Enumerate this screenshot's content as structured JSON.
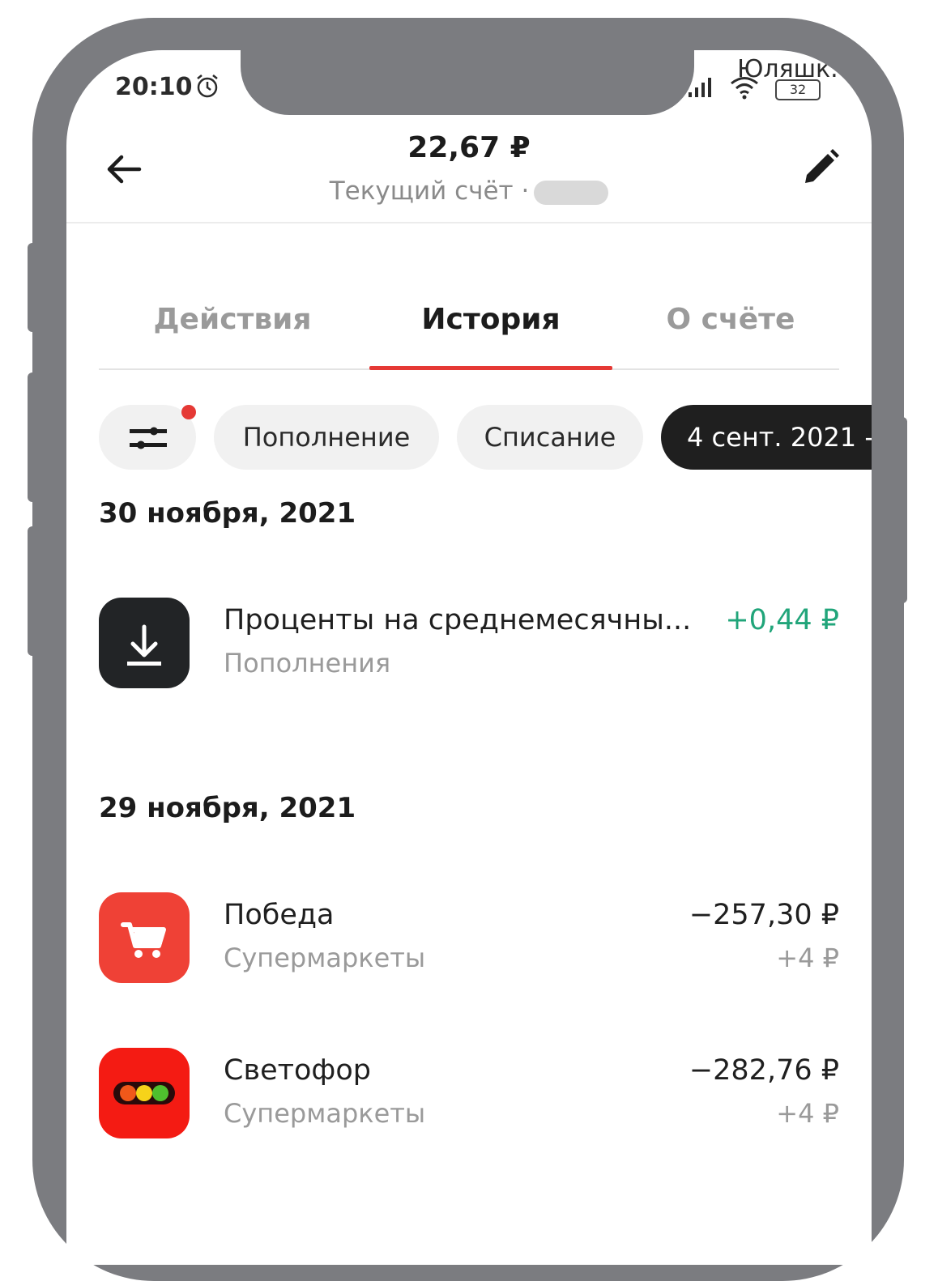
{
  "status_bar": {
    "time": "20:10",
    "carrier": "Юляшк.",
    "battery": "32"
  },
  "header": {
    "balance": "22,67 ₽",
    "account_label": "Текущий счёт ·"
  },
  "tabs": [
    {
      "label": "Действия",
      "active": false
    },
    {
      "label": "История",
      "active": true
    },
    {
      "label": "О счёте",
      "active": false
    }
  ],
  "chips": {
    "topup": "Пополнение",
    "writeoff": "Списание",
    "date_range": "4 сент. 2021 -"
  },
  "groups": [
    {
      "date": "30 ноября, 2021",
      "transactions": [
        {
          "title": "Проценты на среднемесячны...",
          "category": "Пополнения",
          "amount": "+0,44 ₽",
          "icon": "download-icon"
        }
      ]
    },
    {
      "date": "29 ноября, 2021",
      "transactions": [
        {
          "title": "Победа",
          "category": "Супермаркеты",
          "amount": "−257,30 ₽",
          "bonus": "+4 ₽",
          "icon": "cart-icon"
        },
        {
          "title": "Светофор",
          "category": "Супермаркеты",
          "amount": "−282,76 ₽",
          "bonus": "+4 ₽",
          "icon": "traffic-light-icon"
        }
      ]
    }
  ],
  "colors": {
    "accent_red": "#e53935",
    "income_green": "#21a57a",
    "pobeda_red": "#ef4136",
    "svetofor_red": "#f41b13"
  }
}
